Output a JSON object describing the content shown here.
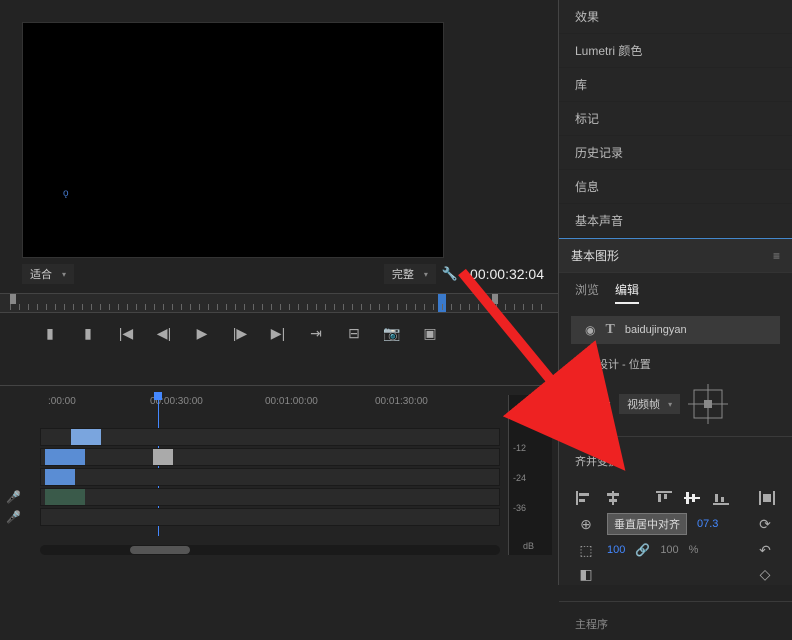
{
  "preview": {
    "fit_label": "适合",
    "quality_label": "完整",
    "timecode": "00:00:32:04"
  },
  "timeline": {
    "times": [
      ":00:00",
      "00:00:30:00",
      "00:01:00:00",
      "00:01:30:00"
    ]
  },
  "side_menu": {
    "items": [
      "效果",
      "Lumetri 颜色",
      "库",
      "标记",
      "历史记录",
      "信息",
      "基本声音"
    ]
  },
  "graphics_panel": {
    "title": "基本图形",
    "tabs": {
      "browse": "浏览",
      "edit": "编辑"
    },
    "layer": {
      "name": "baidujingyan"
    },
    "responsive": {
      "title": "响应设计 - 位置",
      "pin_label": "固定到:",
      "pin_value": "视频帧"
    },
    "align": {
      "title": "齐并变换",
      "tooltip": "垂直居中对齐",
      "pos_y": "07.3",
      "scale": "100",
      "opacity": "100",
      "pct": "%"
    },
    "footer_label": "主程序"
  },
  "meter": {
    "m12": "-12",
    "m24": "-24",
    "m36": "-36",
    "db": "dB"
  }
}
